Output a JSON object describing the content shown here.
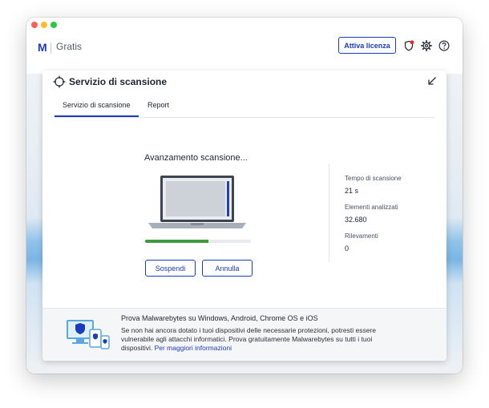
{
  "app": {
    "logo_glyph": "M",
    "edition": "Gratis",
    "license_button": "Attiva licenza",
    "icons": [
      "notification-icon",
      "gear-icon",
      "help-icon"
    ],
    "brand_color": "#1a3cbf",
    "notification_dot_color": "#e0282e"
  },
  "card": {
    "title": "Servizio di scansione",
    "tabs": [
      {
        "label": "Servizio di scansione",
        "active": true
      },
      {
        "label": "Report",
        "active": false
      }
    ]
  },
  "scan": {
    "title": "Avanzamento scansione...",
    "progress_percent": 60,
    "progress_color": "#3d9a3f",
    "suspend_label": "Sospendi",
    "cancel_label": "Annulla"
  },
  "stats": [
    {
      "label": "Tempo di scansione",
      "value": "21 s"
    },
    {
      "label": "Elementi analizzati",
      "value": "32.680"
    },
    {
      "label": "Rilevamenti",
      "value": "0"
    }
  ],
  "promo": {
    "title": "Prova Malwarebytes su Windows, Android, Chrome OS e iOS",
    "body": "Se non hai ancora dotato i tuoi dispositivi delle necessarie protezioni, potresti essere vulnerabile agli attacchi informatici. Prova gratuitamente Malwarebytes su tutti i tuoi dispositivi.",
    "link": "Per maggiori informazioni"
  }
}
